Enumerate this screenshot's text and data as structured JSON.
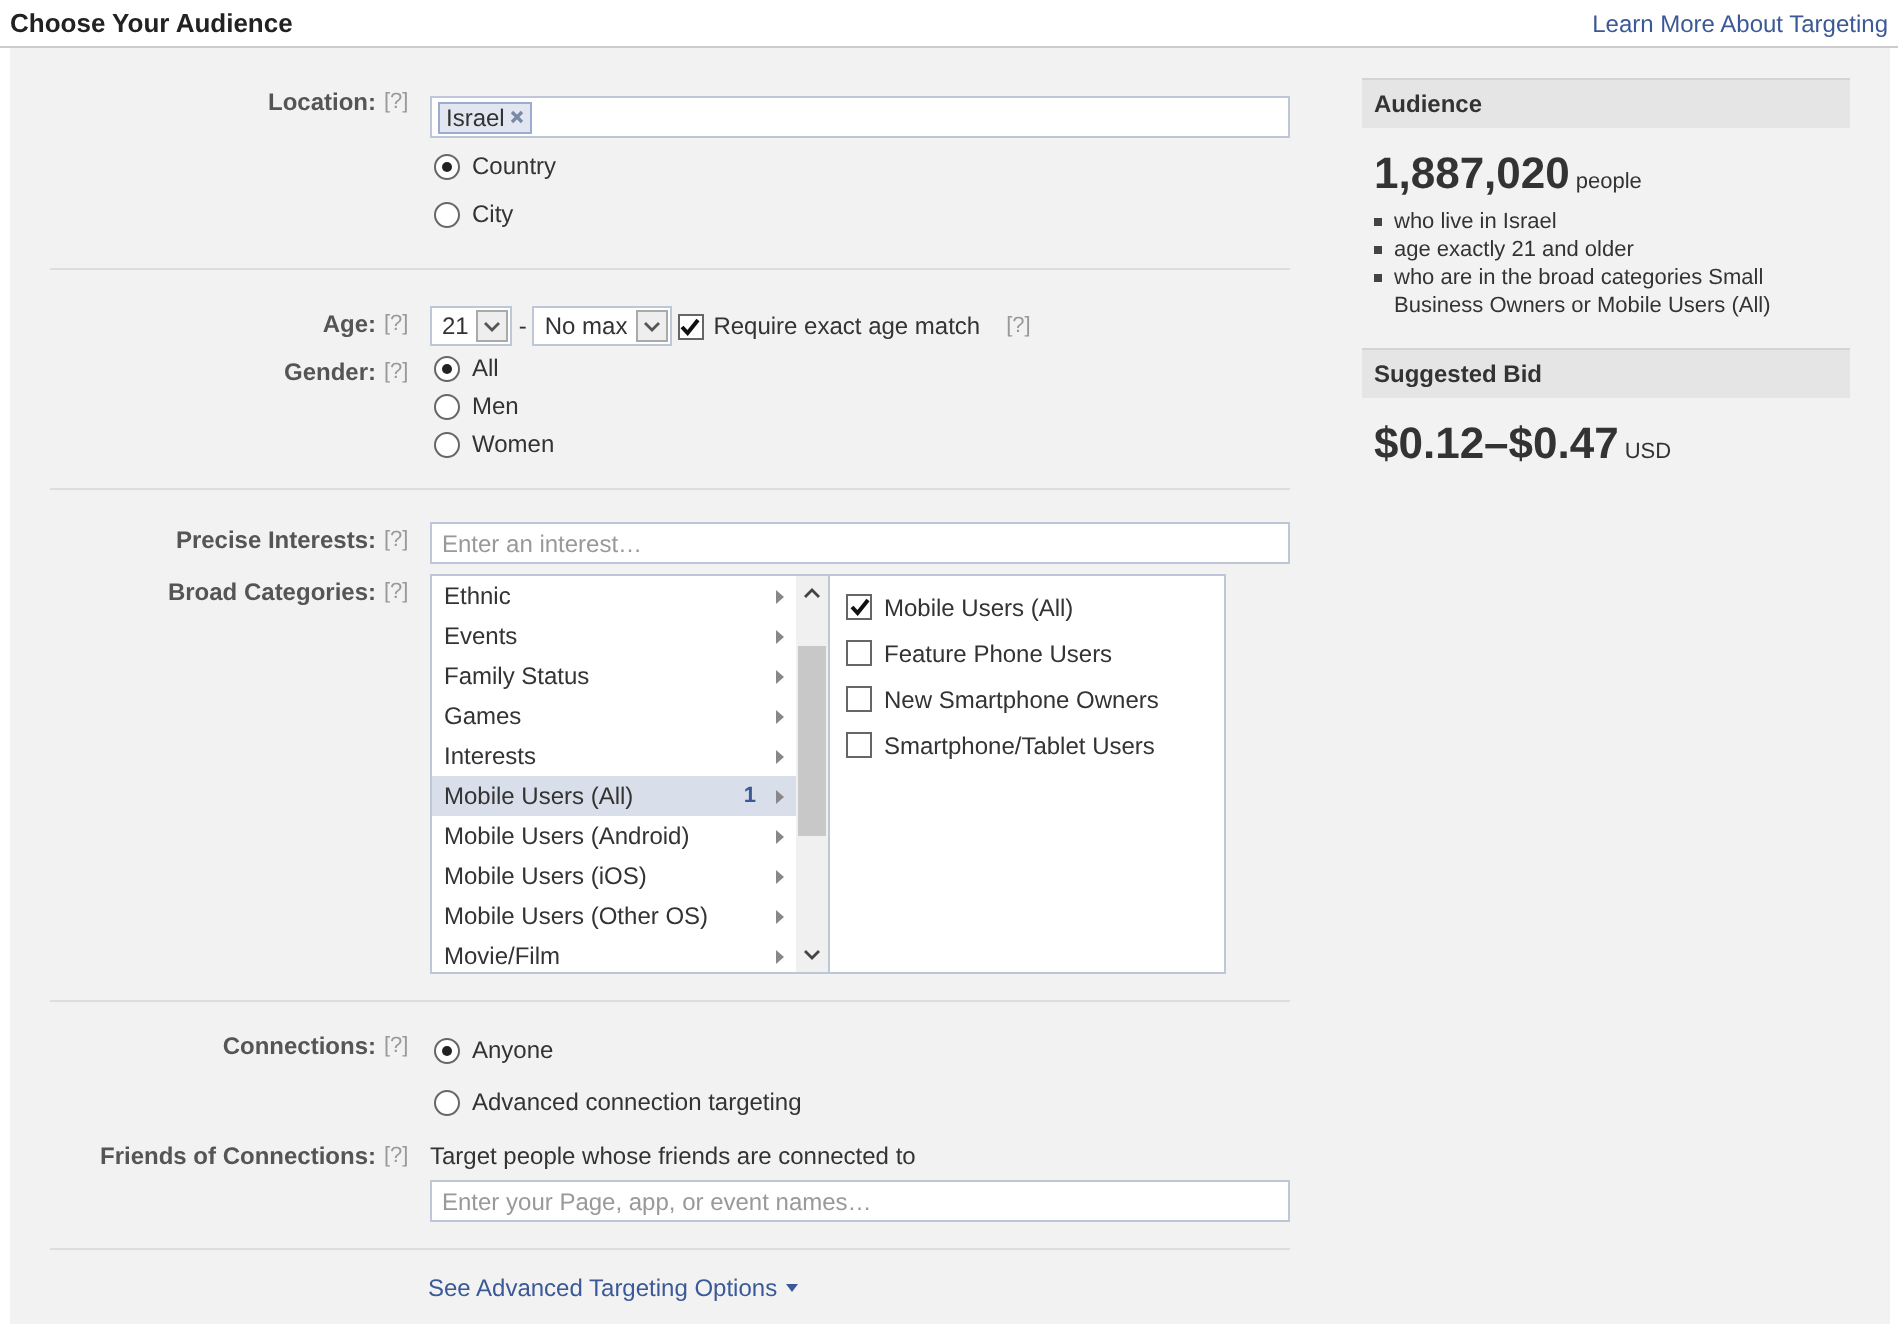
{
  "header": {
    "title": "Choose Your Audience",
    "link": "Learn More About Targeting"
  },
  "form": {
    "location": {
      "label": "Location:",
      "help": "[?]",
      "tokens": [
        "Israel"
      ],
      "options": [
        {
          "label": "Country",
          "selected": true
        },
        {
          "label": "City",
          "selected": false
        }
      ]
    },
    "age": {
      "label": "Age:",
      "help": "[?]",
      "min": "21",
      "separator": "-",
      "max": "No max",
      "exact_match": {
        "label": "Require exact age match",
        "checked": true,
        "help": "[?]"
      }
    },
    "gender": {
      "label": "Gender:",
      "help": "[?]",
      "options": [
        {
          "label": "All",
          "selected": true
        },
        {
          "label": "Men",
          "selected": false
        },
        {
          "label": "Women",
          "selected": false
        }
      ]
    },
    "precise_interests": {
      "label": "Precise Interests:",
      "help": "[?]",
      "placeholder": "Enter an interest…"
    },
    "broad_categories": {
      "label": "Broad Categories:",
      "help": "[?]",
      "categories": [
        {
          "name": "Ethnic",
          "selected": false
        },
        {
          "name": "Events",
          "selected": false
        },
        {
          "name": "Family Status",
          "selected": false
        },
        {
          "name": "Games",
          "selected": false
        },
        {
          "name": "Interests",
          "selected": false
        },
        {
          "name": "Mobile Users (All)",
          "selected": true,
          "count": "1"
        },
        {
          "name": "Mobile Users (Android)",
          "selected": false
        },
        {
          "name": "Mobile Users (iOS)",
          "selected": false
        },
        {
          "name": "Mobile Users (Other OS)",
          "selected": false
        },
        {
          "name": "Movie/Film",
          "selected": false
        }
      ],
      "subcategories": [
        {
          "label": "Mobile Users (All)",
          "checked": true
        },
        {
          "label": "Feature Phone Users",
          "checked": false
        },
        {
          "label": "New Smartphone Owners",
          "checked": false
        },
        {
          "label": "Smartphone/Tablet Users",
          "checked": false
        }
      ]
    },
    "connections": {
      "label": "Connections:",
      "help": "[?]",
      "options": [
        {
          "label": "Anyone",
          "selected": true
        },
        {
          "label": "Advanced connection targeting",
          "selected": false
        }
      ]
    },
    "friends_of_connections": {
      "label": "Friends of Connections:",
      "help": "[?]",
      "description": "Target people whose friends are connected to",
      "placeholder": "Enter your Page, app, or event names…"
    },
    "advanced_link": "See Advanced Targeting Options"
  },
  "audience": {
    "heading": "Audience",
    "count": "1,887,020",
    "unit": "people",
    "criteria": [
      "who live in Israel",
      "age exactly 21 and older",
      "who are in the broad categories Small Business Owners or Mobile Users (All)"
    ]
  },
  "bid": {
    "heading": "Suggested Bid",
    "range": "$0.12–$0.47",
    "currency": "USD"
  }
}
